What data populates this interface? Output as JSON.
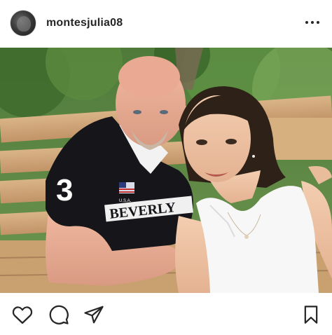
{
  "post": {
    "username": "montesjulia08",
    "avatar_icon": "profile-avatar",
    "more_icon": "more-options-icon"
  },
  "photo": {
    "shirt_text": "BEVERLY",
    "shirt_number": "3",
    "flag_caption": "U.S.A."
  },
  "actions": {
    "like_icon": "heart-icon",
    "comment_icon": "comment-icon",
    "share_icon": "send-icon",
    "save_icon": "bookmark-icon"
  },
  "colors": {
    "text": "#262626",
    "background": "#ffffff"
  }
}
